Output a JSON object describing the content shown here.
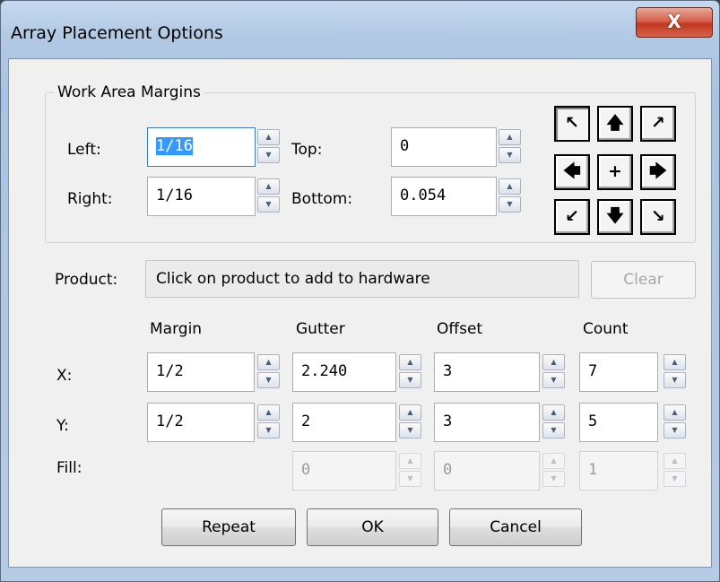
{
  "window": {
    "title": "Array Placement Options",
    "close_label": "X"
  },
  "work_area": {
    "group_label": "Work Area Margins",
    "left": {
      "label": "Left:",
      "value": "1/16"
    },
    "right": {
      "label": "Right:",
      "value": "1/16"
    },
    "top": {
      "label": "Top:",
      "value": "0"
    },
    "bottom": {
      "label": "Bottom:",
      "value": "0.054"
    },
    "alignment_arrows": {
      "top_left": "↖",
      "up": "🡅",
      "top_right": "↗",
      "left": "🡄",
      "center": "+",
      "right": "🡆",
      "bottom_left": "↙",
      "down": "🡇",
      "bottom_right": "↘"
    }
  },
  "product": {
    "label": "Product:",
    "text": "Click on product to add to hardware",
    "clear_label": "Clear"
  },
  "grid": {
    "headers": [
      "Margin",
      "Gutter",
      "Offset",
      "Count"
    ],
    "rows": [
      {
        "label": "X:",
        "margin": "1/2",
        "gutter": "2.240",
        "offset": "3",
        "count": "7"
      },
      {
        "label": "Y:",
        "margin": "1/2",
        "gutter": "2",
        "offset": "3",
        "count": "5"
      }
    ],
    "fill": {
      "label": "Fill:",
      "gutter": "0",
      "offset": "0",
      "count": "1"
    }
  },
  "buttons": {
    "repeat": "Repeat",
    "ok": "OK",
    "cancel": "Cancel"
  }
}
